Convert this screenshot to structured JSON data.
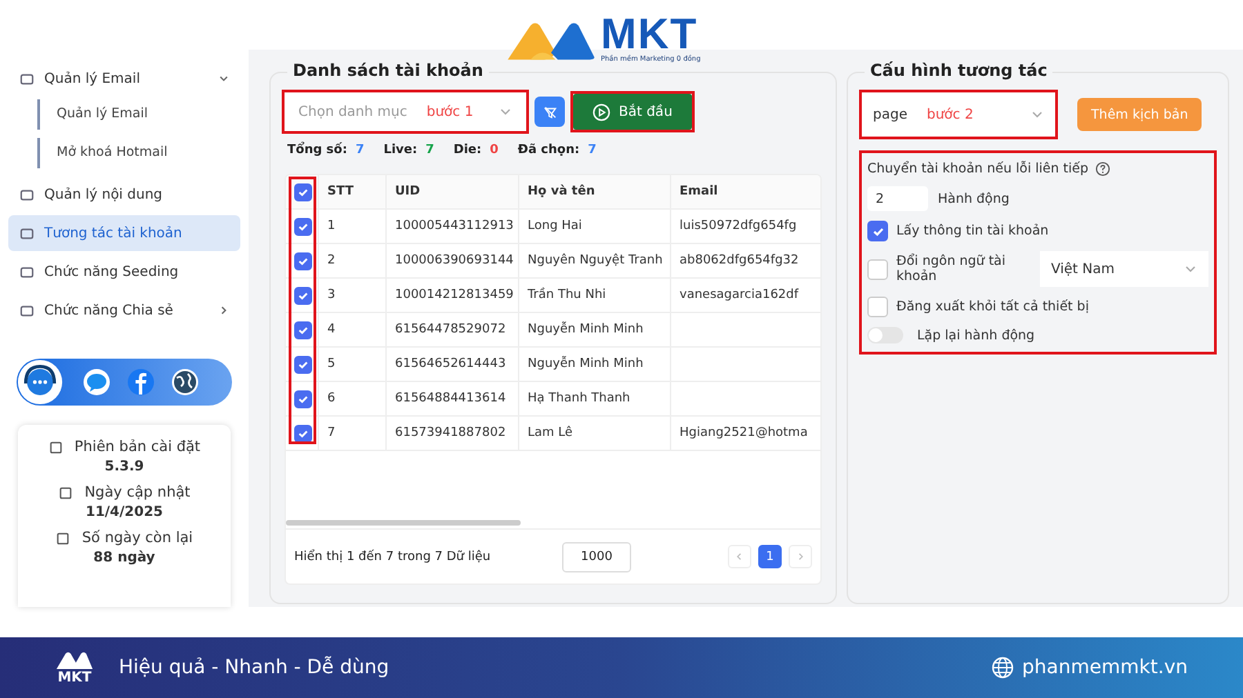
{
  "header": {
    "logo_text": "MKT",
    "logo_tagline": "Phần mềm Marketing 0 đồng"
  },
  "sidebar": {
    "items": [
      {
        "kind": "group",
        "label": "Quản lý Email",
        "selected": false,
        "expanded": true,
        "children": [
          {
            "label": "Quản lý Email",
            "selected": false
          },
          {
            "label": "Mở khoá Hotmail",
            "selected": false
          }
        ]
      },
      {
        "kind": "link",
        "label": "Quản lý nội dung",
        "selected": false
      },
      {
        "kind": "link",
        "label": "Tương tác tài khoản",
        "selected": true
      },
      {
        "kind": "link",
        "label": "Chức năng Seeding",
        "selected": false
      },
      {
        "kind": "group",
        "label": "Chức năng Chia sẻ",
        "selected": false,
        "expanded": false
      }
    ],
    "info": [
      {
        "label": "Phiên bản cài đặt",
        "value": "5.3.9"
      },
      {
        "label": "Ngày cập nhật",
        "value": "11/4/2025"
      },
      {
        "label": "Số ngày còn lại",
        "value": "88 ngày"
      }
    ]
  },
  "accounts": {
    "title": "Danh sách tài khoản",
    "category_placeholder": "Chọn danh mục",
    "step_label": "bước 1",
    "start_button": "Bắt đầu",
    "stats": [
      {
        "label": "Tổng số:",
        "value": "7",
        "color": "#3b82f6"
      },
      {
        "label": "Live:",
        "value": "7",
        "color": "#16a34a"
      },
      {
        "label": "Die:",
        "value": "0",
        "color": "#ef4444"
      },
      {
        "label": "Đã chọn:",
        "value": "7",
        "color": "#3b82f6"
      }
    ],
    "table": {
      "columns": [
        "STT",
        "UID",
        "Họ và tên",
        "Email"
      ],
      "all_checked": true,
      "rows": [
        {
          "checked": true,
          "cells": [
            "1",
            "100005443112913",
            "Long Hai",
            "luis50972dfg654fg"
          ]
        },
        {
          "checked": true,
          "cells": [
            "2",
            "100006390693144",
            "Nguyên Nguyệt Tranh",
            "ab8062dfg654fg32"
          ]
        },
        {
          "checked": true,
          "cells": [
            "3",
            "100014212813459",
            "Trần Thu Nhi",
            "vanesagarcia162df"
          ]
        },
        {
          "checked": true,
          "cells": [
            "4",
            "61564478529072",
            "Nguyễn Minh Minh",
            ""
          ]
        },
        {
          "checked": true,
          "cells": [
            "5",
            "61564652614443",
            "Nguyễn Minh Minh",
            ""
          ]
        },
        {
          "checked": true,
          "cells": [
            "6",
            "61564884413614",
            "Hạ Thanh Thanh",
            ""
          ]
        },
        {
          "checked": true,
          "cells": [
            "7",
            "61573941887802",
            "Lam Lê",
            "Hgiang2521@hotma"
          ]
        }
      ]
    },
    "pagination": {
      "summary": "Hiển thị 1 đến 7 trong 7 Dữ liệu",
      "page_size": "1000",
      "pages": [
        {
          "label": "1",
          "selected": true
        }
      ]
    }
  },
  "config": {
    "title": "Cấu hình tương tác",
    "select_value": "page",
    "step_label": "bước 2",
    "add_button": "Thêm kịch bản",
    "switch_label": "Chuyển tài khoản nếu lỗi liên tiếp",
    "count_value": "2",
    "count_unit": "Hành động",
    "options": [
      {
        "kind": "checkbox",
        "label": "Lấy thông tin tài khoản",
        "checked": true
      },
      {
        "kind": "checkbox-select",
        "label": "Đổi ngôn ngữ tài khoản",
        "checked": false,
        "select_value": "Việt Nam"
      },
      {
        "kind": "checkbox",
        "label": "Đăng xuất khỏi tất cả thiết bị",
        "checked": false
      },
      {
        "kind": "toggle",
        "label": "Lặp lại hành động",
        "on": false
      }
    ]
  },
  "footer": {
    "logo_text": "MKT",
    "slogan": "Hiệu quả - Nhanh - Dễ dùng",
    "website": "phanmemmkt.vn"
  }
}
